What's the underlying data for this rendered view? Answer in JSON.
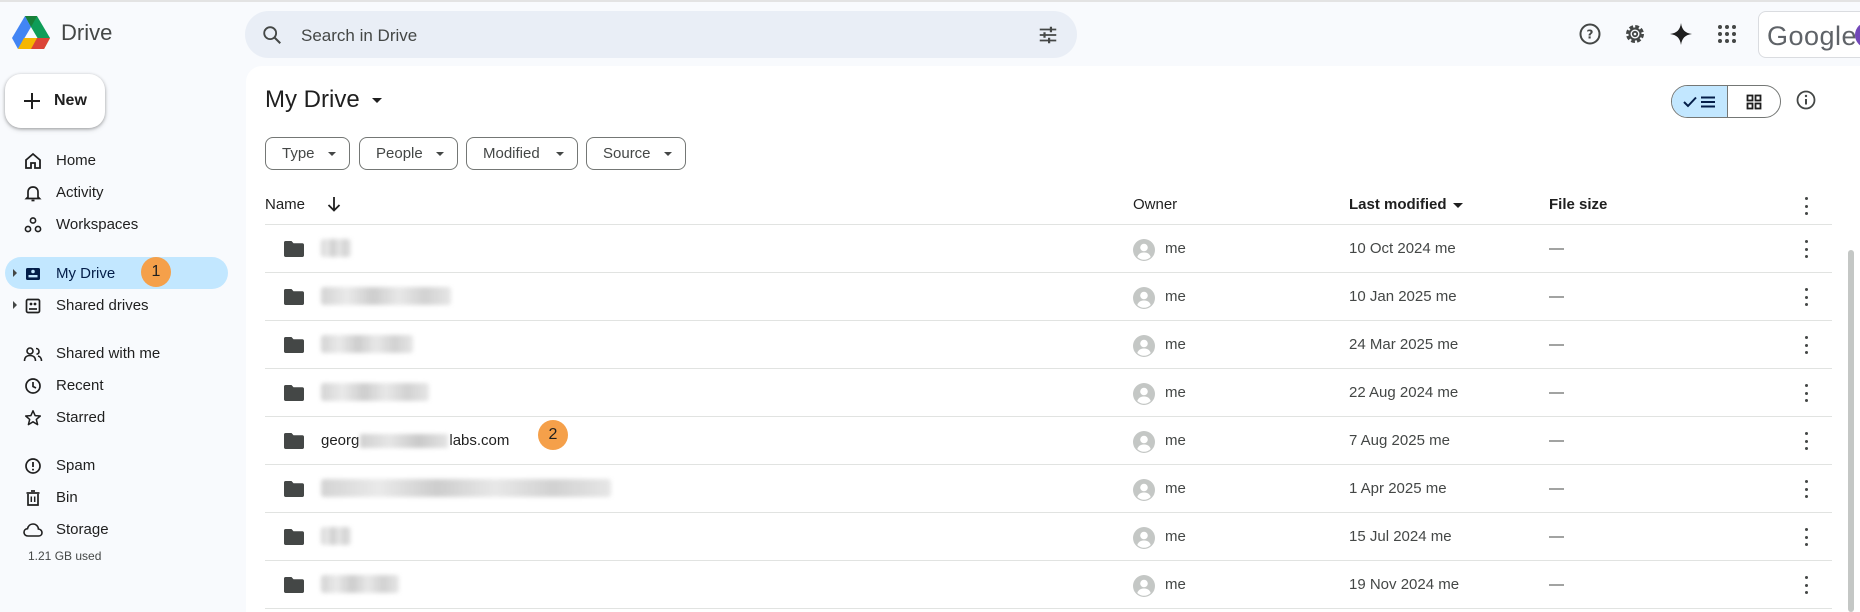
{
  "app": {
    "name": "Drive",
    "brand_colors": {
      "blue": "#4285f4",
      "green": "#0f9d58",
      "yellow": "#f4b400",
      "red": "#db4437"
    }
  },
  "search": {
    "placeholder": "Search in Drive"
  },
  "header": {
    "account_label": "Google"
  },
  "sidebar": {
    "new_label": "New",
    "items": [
      {
        "label": "Home",
        "icon": "home-icon"
      },
      {
        "label": "Activity",
        "icon": "bell-icon"
      },
      {
        "label": "Workspaces",
        "icon": "workspaces-icon"
      },
      {
        "label": "My Drive",
        "icon": "my-drive-icon",
        "active": true
      },
      {
        "label": "Shared drives",
        "icon": "shared-drives-icon"
      },
      {
        "label": "Shared with me",
        "icon": "people-icon"
      },
      {
        "label": "Recent",
        "icon": "clock-icon"
      },
      {
        "label": "Starred",
        "icon": "star-icon"
      },
      {
        "label": "Spam",
        "icon": "spam-icon"
      },
      {
        "label": "Bin",
        "icon": "bin-icon"
      },
      {
        "label": "Storage",
        "icon": "cloud-icon"
      }
    ],
    "storage_used": "1.21 GB used"
  },
  "main": {
    "title": "My Drive",
    "filters": [
      "Type",
      "People",
      "Modified",
      "Source"
    ],
    "columns": {
      "name": "Name",
      "owner": "Owner",
      "last_modified": "Last modified",
      "file_size": "File size"
    },
    "rows": [
      {
        "name": "",
        "owner": "me",
        "modified": "10 Oct 2024 me",
        "size": "—"
      },
      {
        "name": "",
        "owner": "me",
        "modified": "10 Jan 2025 me",
        "size": "—"
      },
      {
        "name": "",
        "owner": "me",
        "modified": "24 Mar 2025 me",
        "size": "—"
      },
      {
        "name": "",
        "owner": "me",
        "modified": "22 Aug 2024 me",
        "size": "—"
      },
      {
        "name_start": "georg",
        "name_end": "labs.com",
        "owner": "me",
        "modified": "7 Aug 2025 me",
        "size": "—"
      },
      {
        "name": "",
        "owner": "me",
        "modified": "1 Apr 2025 me",
        "size": "—"
      },
      {
        "name": "",
        "owner": "me",
        "modified": "15 Jul 2024 me",
        "size": "—"
      },
      {
        "name": "",
        "owner": "me",
        "modified": "19 Nov 2024 me",
        "size": "—"
      }
    ]
  },
  "annotations": {
    "badge_1": "1",
    "badge_2": "2"
  }
}
